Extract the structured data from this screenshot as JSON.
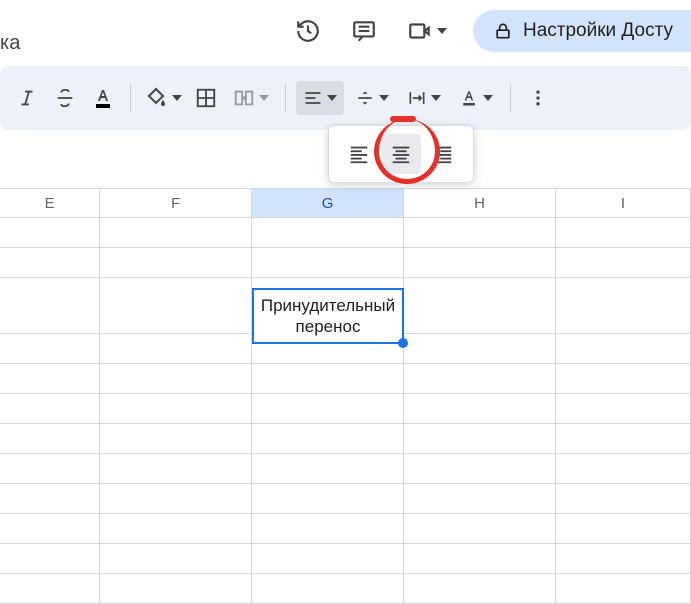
{
  "header": {
    "doc_subtitle": "ка",
    "share_label": "Настройки Досту"
  },
  "toolbar": {
    "italic_icon": "italic",
    "strike_icon": "strikethrough",
    "text_color_icon": "text-color",
    "fill_color_icon": "fill-color",
    "borders_icon": "borders",
    "merge_icon": "merge-cells",
    "h_align_icon": "align-left",
    "v_align_icon": "align-middle",
    "wrap_icon": "text-wrap",
    "rotate_icon": "text-rotate",
    "more_icon": "more-vert"
  },
  "align_popup": {
    "options": [
      "align-left",
      "align-center",
      "align-right"
    ],
    "selected": "align-center"
  },
  "sheet": {
    "columns": [
      "E",
      "F",
      "G",
      "H",
      "I"
    ],
    "selected_column": "G",
    "selected_cell_value": "Принудительный перенос"
  },
  "colors": {
    "accent": "#1a73e8",
    "toolbar_bg": "#edf2fa",
    "share_bg": "#d3e3fd",
    "annotation": "#e4312b"
  }
}
